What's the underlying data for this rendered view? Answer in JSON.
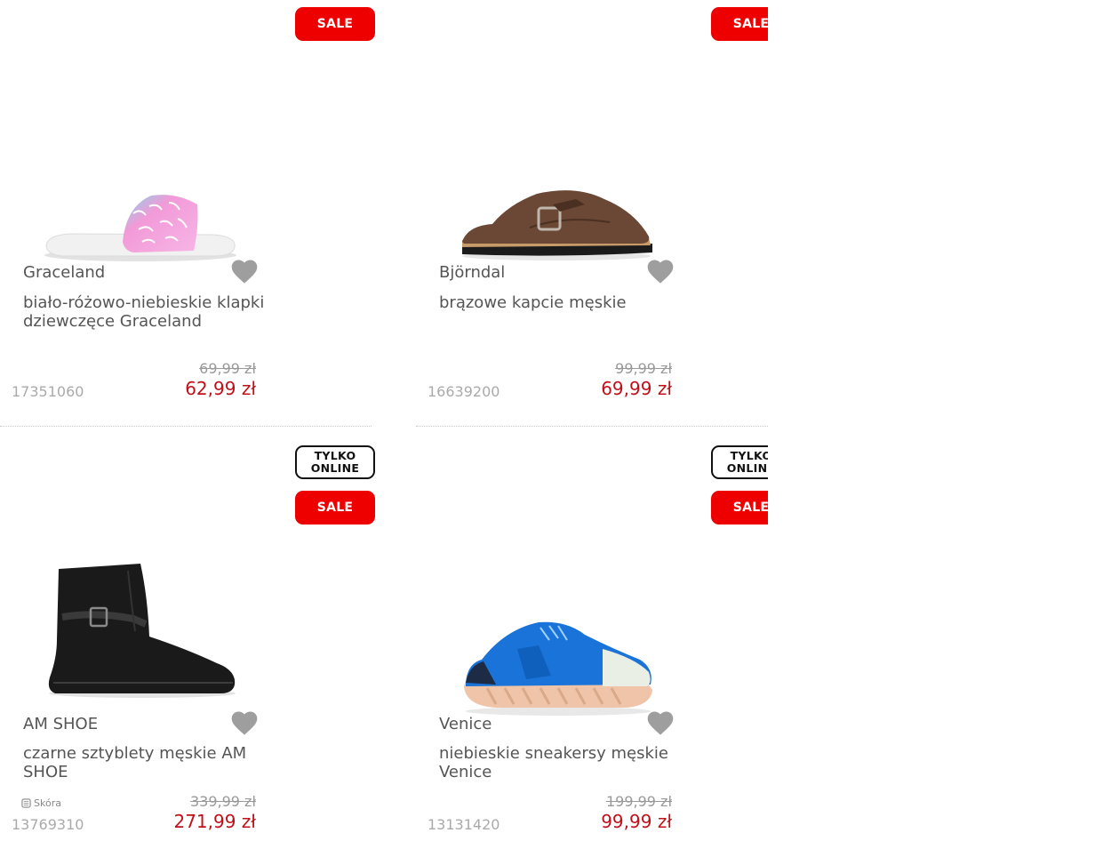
{
  "colors": {
    "sale_red": "#ee0000",
    "price_red": "#c0101a",
    "text": "#555555",
    "muted": "#aaaaaa"
  },
  "badges": {
    "sale": "SALE",
    "online_line1": "TYLKO",
    "online_line2": "ONLINE"
  },
  "products": [
    {
      "brand": "Graceland",
      "title": "biało-różowo-niebieskie klapki dziewczęce Graceland",
      "price_old": "69,99",
      "currency": "zł",
      "price_new": "62,99 zł",
      "sku": "17351060",
      "image_icon": "slide-sandal-image",
      "badges": [
        "sale"
      ]
    },
    {
      "brand": "Björndal",
      "title": "brązowe kapcie męskie",
      "price_old": "99,99",
      "currency": "zł",
      "price_new": "69,99 zł",
      "sku": "16639200",
      "image_icon": "clog-slipper-image",
      "badges": [
        "sale"
      ]
    },
    {
      "brand": "AM SHOE",
      "title": "czarne sztyblety męskie AM SHOE",
      "price_old": "339,99",
      "currency": "zł",
      "price_new": "271,99 zł",
      "sku": "13769310",
      "material": "Skóra",
      "image_icon": "ankle-boot-image",
      "badges": [
        "online",
        "sale"
      ]
    },
    {
      "brand": "Venice",
      "title": "niebieskie sneakersy męskie Venice",
      "price_old": "199,99",
      "currency": "zł",
      "price_new": "99,99 zł",
      "sku": "13131420",
      "image_icon": "sneaker-image",
      "badges": [
        "online",
        "sale"
      ]
    }
  ]
}
